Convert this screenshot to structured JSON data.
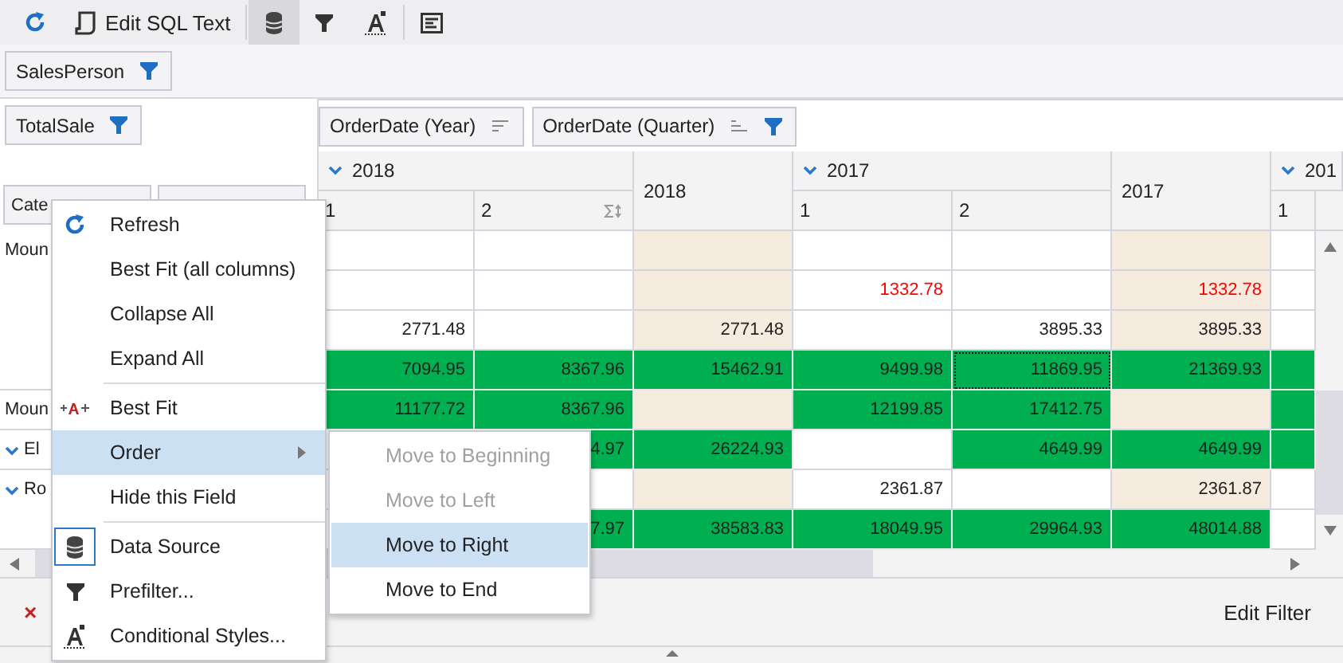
{
  "toolbar": [
    {
      "kind": "icon",
      "selected": false
    },
    {
      "kind": "button",
      "label": "Edit SQL Text",
      "selected": false
    },
    {
      "kind": "separator"
    },
    {
      "kind": "icon",
      "selected": true
    },
    {
      "kind": "icon",
      "selected": false
    },
    {
      "kind": "icon",
      "selected": false
    },
    {
      "kind": "separator"
    },
    {
      "kind": "icon",
      "selected": false
    }
  ],
  "filter_area": {
    "fields": [
      {
        "label": "SalesPerson",
        "filtered": true
      }
    ]
  },
  "data_area": {
    "fields": [
      {
        "label": "TotalSale",
        "filtered": true
      }
    ]
  },
  "column_area": {
    "fields": [
      {
        "label": "OrderDate (Year)",
        "filtered": false
      },
      {
        "label": "OrderDate (Quarter)",
        "filtered": true
      }
    ]
  },
  "row_area": {
    "fields": [
      {
        "label": "Cate",
        "filtered": false
      },
      {
        "filtered": false
      }
    ]
  },
  "column_header": [
    {
      "label": "2018",
      "expanded": true,
      "quarters": [
        "1",
        "2"
      ],
      "total": "2018"
    },
    {
      "label": "2017",
      "expanded": true,
      "quarters": [
        "1",
        "2"
      ],
      "total": "2017"
    },
    {
      "label": "201",
      "expanded": true,
      "quarters": [
        "1"
      ]
    }
  ],
  "row_groups": [
    {
      "label": "Moun",
      "rows": [
        [
          {
            "kind": "plain"
          },
          {
            "kind": "plain"
          },
          {
            "kind": "total"
          },
          {
            "kind": "plain"
          },
          {
            "kind": "plain"
          },
          {
            "kind": "total"
          },
          {
            "kind": "plain"
          }
        ],
        [
          {
            "kind": "plain"
          },
          {
            "kind": "plain"
          },
          {
            "kind": "total"
          },
          {
            "text": "1332.78",
            "kind": "alert"
          },
          {
            "kind": "plain"
          },
          {
            "text": "1332.78",
            "kind": "total-alert"
          },
          {
            "kind": "plain"
          }
        ],
        [
          {
            "text": "2771.48",
            "kind": "plain"
          },
          {
            "kind": "plain"
          },
          {
            "text": "2771.48",
            "kind": "total"
          },
          {
            "kind": "plain"
          },
          {
            "text": "3895.33",
            "kind": "plain"
          },
          {
            "text": "3895.33",
            "kind": "total"
          },
          {
            "kind": "plain"
          }
        ],
        [
          {
            "text": "7094.95",
            "kind": "green"
          },
          {
            "text": "8367.96",
            "kind": "green"
          },
          {
            "text": "15462.91",
            "kind": "green"
          },
          {
            "text": "9499.98",
            "kind": "green"
          },
          {
            "text": "11869.95",
            "kind": "green",
            "focused": true
          },
          {
            "text": "21369.93",
            "kind": "green"
          },
          {
            "kind": "green"
          }
        ]
      ]
    },
    {
      "label": "Moun",
      "rows": [
        [
          {
            "text": "11177.72",
            "kind": "green"
          },
          {
            "text": "8367.96",
            "kind": "green"
          },
          {
            "kind": "total"
          },
          {
            "text": "12199.85",
            "kind": "green"
          },
          {
            "text": "17412.75",
            "kind": "green"
          },
          {
            "kind": "total"
          },
          {
            "kind": "green"
          }
        ]
      ]
    },
    {
      "label": "El",
      "expanded": true,
      "rows": [
        [
          {
            "text": "4.97",
            "kind": "green"
          },
          {
            "text": "26224.93",
            "kind": "green"
          },
          {
            "kind": "plain"
          },
          {
            "text": "4649.99",
            "kind": "green"
          },
          {
            "text": "4649.99",
            "kind": "green"
          },
          {
            "kind": "green"
          }
        ]
      ]
    },
    {
      "label": "Ro",
      "expanded": true,
      "rows": [
        [
          {
            "kind": "plain"
          },
          {
            "kind": "total"
          },
          {
            "text": "2361.87",
            "kind": "plain"
          },
          {
            "kind": "plain"
          },
          {
            "text": "2361.87",
            "kind": "total"
          },
          {
            "kind": "plain"
          }
        ],
        [
          {
            "text": "7.97",
            "kind": "green"
          },
          {
            "text": "38583.83",
            "kind": "green"
          },
          {
            "text": "18049.95",
            "kind": "green"
          },
          {
            "text": "29964.93",
            "kind": "green"
          },
          {
            "text": "48014.88",
            "kind": "green"
          },
          {
            "kind": "plain"
          }
        ]
      ]
    }
  ],
  "filter_panel": {
    "clear": "×",
    "edit": "Edit Filter"
  },
  "context_menu": [
    [
      {
        "label": "Refresh",
        "kind": "command",
        "selected": false,
        "checked": false
      },
      {
        "label": "Best Fit (all columns)",
        "kind": "command",
        "selected": false,
        "checked": false
      },
      {
        "label": "Collapse All",
        "kind": "command",
        "selected": false,
        "checked": false
      },
      {
        "label": "Expand All",
        "kind": "command",
        "selected": false,
        "checked": false
      }
    ],
    [
      {
        "label": "Best Fit",
        "kind": "command",
        "selected": false,
        "checked": false
      },
      {
        "label": "Order",
        "kind": "submenu",
        "selected": true,
        "checked": false
      },
      {
        "label": "Hide this Field",
        "kind": "command",
        "selected": false,
        "checked": false
      }
    ],
    [
      {
        "label": "Data Source",
        "kind": "command",
        "selected": false,
        "checked": true
      },
      {
        "label": "Prefilter...",
        "kind": "command",
        "selected": false,
        "checked": false
      },
      {
        "label": "Conditional Styles...",
        "kind": "command",
        "selected": false,
        "checked": false
      }
    ]
  ],
  "submenu": [
    {
      "label": "Move to Beginning",
      "disabled": true,
      "selected": false
    },
    {
      "label": "Move to Left",
      "disabled": true,
      "selected": false
    },
    {
      "label": "Move to Right",
      "disabled": false,
      "selected": true
    },
    {
      "label": "Move to End",
      "disabled": false,
      "selected": false
    }
  ]
}
